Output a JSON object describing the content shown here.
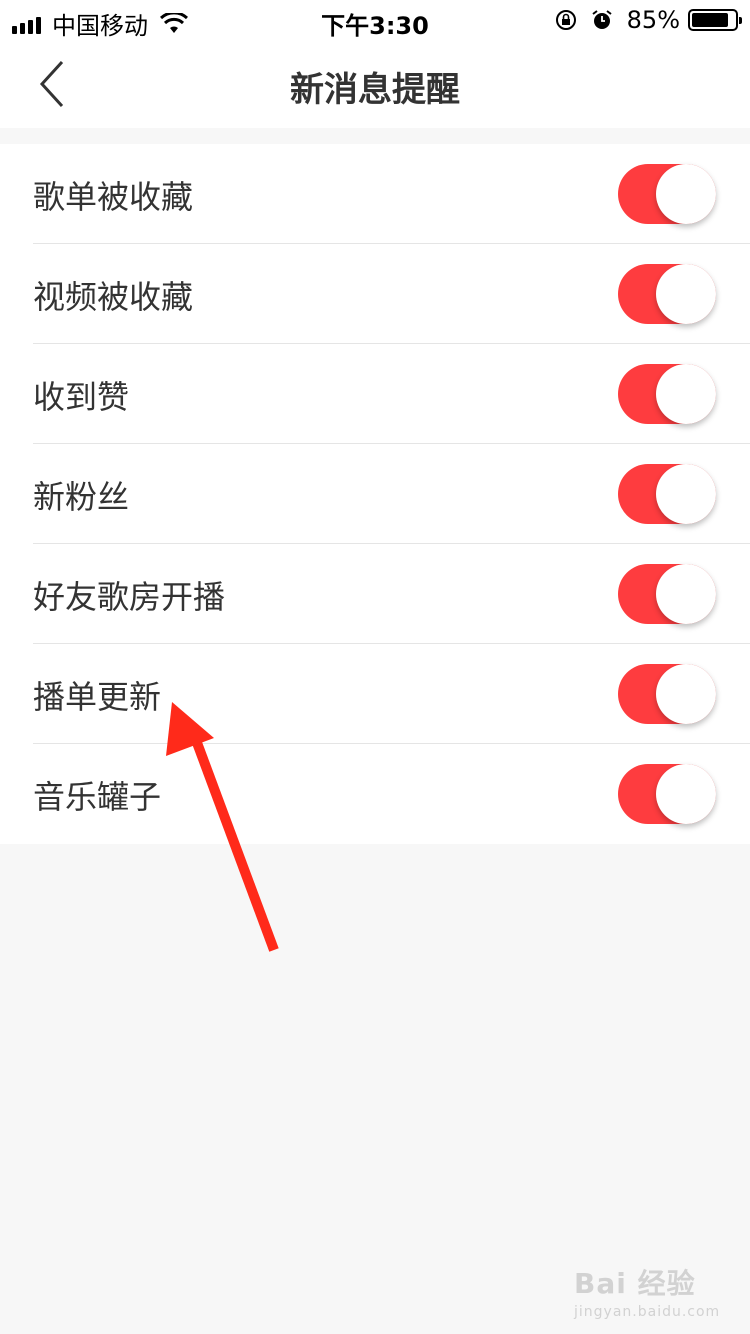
{
  "status_bar": {
    "carrier": "中国移动",
    "time": "下午3:30",
    "battery": "85%",
    "battery_level": 0.85
  },
  "nav": {
    "title": "新消息提醒",
    "back_icon": "chevron-left-icon"
  },
  "settings": [
    {
      "label": "歌单被收藏",
      "enabled": true
    },
    {
      "label": "视频被收藏",
      "enabled": true
    },
    {
      "label": "收到赞",
      "enabled": true
    },
    {
      "label": "新粉丝",
      "enabled": true
    },
    {
      "label": "好友歌房开播",
      "enabled": true
    },
    {
      "label": "播单更新",
      "enabled": true
    },
    {
      "label": "音乐罐子",
      "enabled": true
    }
  ],
  "colors": {
    "accent": "#fe3c3f",
    "annotation_arrow": "#ff2a1a",
    "background": "#f7f7f7"
  },
  "watermark": {
    "main": "Bai 经验",
    "sub": "jingyan.baidu.com"
  }
}
